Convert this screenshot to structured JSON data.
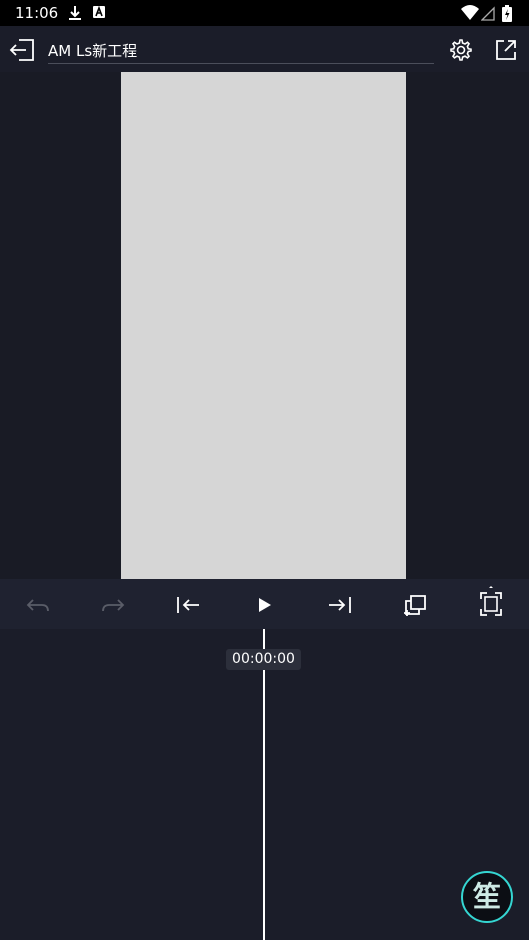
{
  "status_bar": {
    "time": "11:06",
    "icons": [
      "download-icon",
      "a-badge-icon",
      "wifi-icon",
      "signal-icon",
      "battery-icon"
    ]
  },
  "app_bar": {
    "title": "AM Ls新工程",
    "back_icon": "exit-back-icon",
    "settings_icon": "gear-icon",
    "share_icon": "export-icon"
  },
  "controls": {
    "icons": [
      "undo-icon",
      "redo-icon",
      "skip-to-start-icon",
      "play-icon",
      "skip-to-end-icon",
      "copy-add-icon",
      "fullscreen-icon"
    ]
  },
  "timeline": {
    "timecode": "00:00:00"
  },
  "fab": {
    "glyph": "笙"
  },
  "colors": {
    "background": "#1b1d29",
    "preview_background": "#191b25",
    "canvas": "#d6d6d6",
    "controls_bar": "#1f2230",
    "fab_ring": "#35d6d2",
    "disabled_icon": "#5a5d68"
  }
}
